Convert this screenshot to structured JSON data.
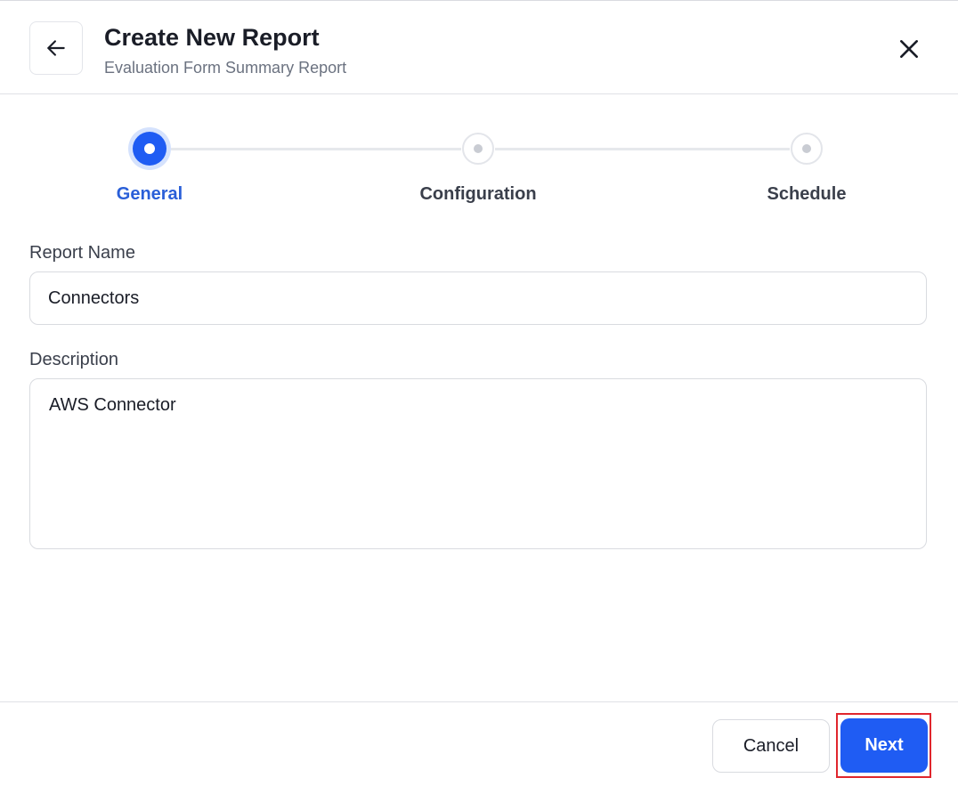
{
  "header": {
    "title": "Create New Report",
    "subtitle": "Evaluation Form Summary Report",
    "back_icon": "arrow-left-icon",
    "close_icon": "close-icon"
  },
  "stepper": {
    "active_index": 0,
    "steps": [
      {
        "label": "General",
        "state": "active"
      },
      {
        "label": "Configuration",
        "state": "inactive"
      },
      {
        "label": "Schedule",
        "state": "inactive"
      }
    ]
  },
  "form": {
    "report_name": {
      "label": "Report Name",
      "value": "Connectors"
    },
    "description": {
      "label": "Description",
      "value": "AWS Connector"
    }
  },
  "footer": {
    "cancel_label": "Cancel",
    "next_label": "Next"
  },
  "colors": {
    "accent": "#1f5cf3",
    "active_label": "#2a5fd8",
    "highlight_outline": "#e0262d"
  }
}
